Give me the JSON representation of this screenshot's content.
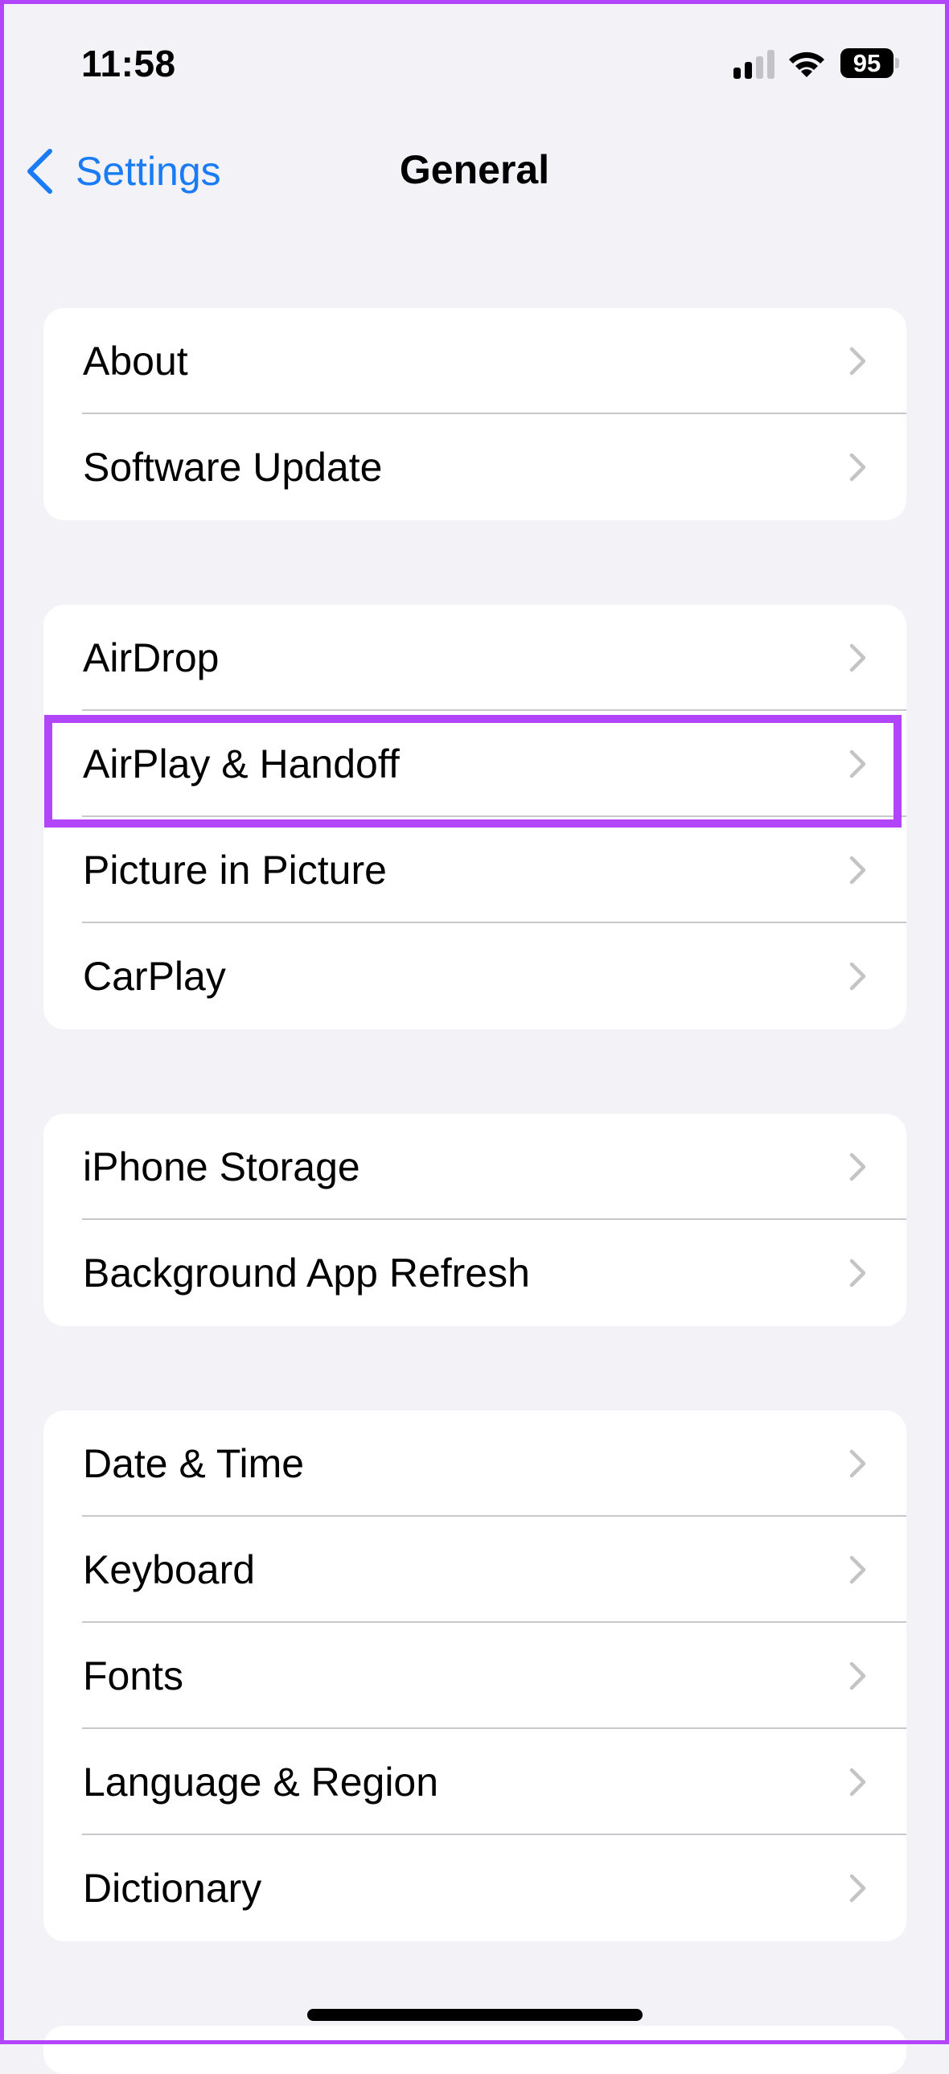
{
  "status_bar": {
    "time": "11:58",
    "signal_bars_active": 2,
    "signal_bars_total": 4,
    "wifi_icon": "wifi-icon",
    "battery_percent": "95"
  },
  "nav": {
    "back_label": "Settings",
    "back_icon": "chevron-left-icon",
    "title": "General"
  },
  "groups": [
    {
      "items": [
        {
          "label": "About"
        },
        {
          "label": "Software Update"
        }
      ]
    },
    {
      "items": [
        {
          "label": "AirDrop"
        },
        {
          "label": "AirPlay & Handoff",
          "highlighted": true
        },
        {
          "label": "Picture in Picture"
        },
        {
          "label": "CarPlay"
        }
      ]
    },
    {
      "items": [
        {
          "label": "iPhone Storage"
        },
        {
          "label": "Background App Refresh"
        }
      ]
    },
    {
      "items": [
        {
          "label": "Date & Time"
        },
        {
          "label": "Keyboard"
        },
        {
          "label": "Fonts"
        },
        {
          "label": "Language & Region"
        },
        {
          "label": "Dictionary"
        }
      ]
    }
  ],
  "colors": {
    "accent": "#1A7CF5",
    "highlight": "#B145FA",
    "background": "#F2F2F7",
    "chevron": "#C4C4C6"
  }
}
